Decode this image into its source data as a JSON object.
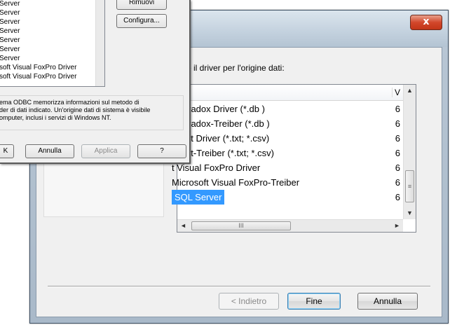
{
  "create_dialog": {
    "close_label": "x",
    "prompt": "re il driver per l'origine dati:",
    "list": {
      "header_col2": "V",
      "rows": [
        {
          "name": "t Paradox Driver (*.db )",
          "version": "6"
        },
        {
          "name": "t Paradox-Treiber (*.db )",
          "version": "6"
        },
        {
          "name": "t Text Driver (*.txt; *.csv)",
          "version": "6"
        },
        {
          "name": "t Text-Treiber (*.txt; *.csv)",
          "version": "6"
        },
        {
          "name": "t Visual FoxPro Driver",
          "version": "6"
        },
        {
          "name": "Microsoft Visual FoxPro-Treiber",
          "version": "6"
        },
        {
          "name": "SQL Server",
          "version": "6"
        }
      ],
      "selected_index": 6,
      "scroll_up": "▲",
      "scroll_down": "▼",
      "scroll_left": "◄",
      "scroll_right": "►",
      "thumb_grip": "≡",
      "hthumb_grip": "III"
    },
    "buttons": {
      "back": "< Indietro",
      "finish": "Fine",
      "cancel": "Annulla"
    }
  },
  "odbc_dialog": {
    "list_items": [
      "Server",
      "Server",
      "Server",
      "Server",
      "Server",
      "Server",
      "Server",
      "soft Visual FoxPro Driver",
      "soft Visual FoxPro Driver"
    ],
    "buttons": {
      "remove": "Rimuovi",
      "configure": "Configura...",
      "ok": "K",
      "cancel": "Annulla",
      "apply": "Applica",
      "help": "?"
    },
    "info_lines": [
      "ema ODBC memorizza informazioni sul metodo di",
      "der di dati indicato. Un'origine dati di sistema è visibile",
      "omputer, inclusi i servizi di Windows NT."
    ]
  }
}
